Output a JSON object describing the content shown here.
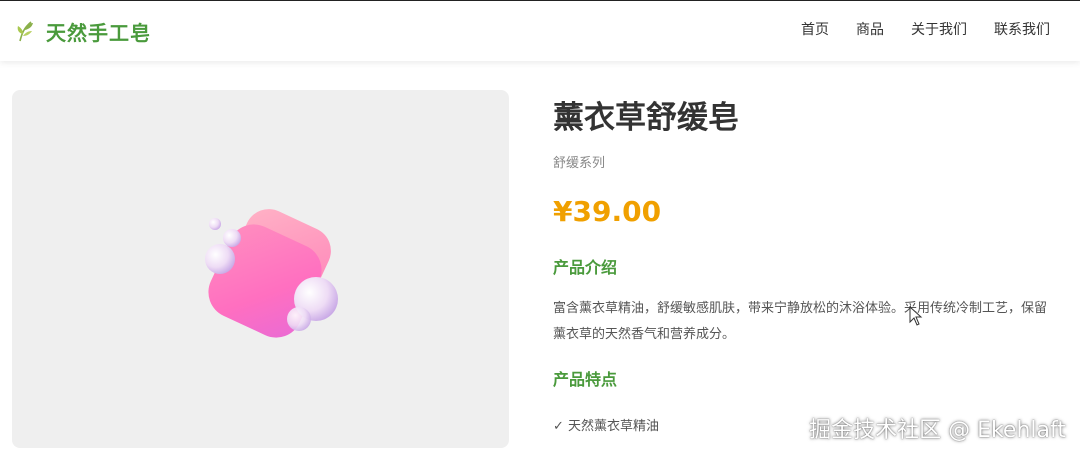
{
  "header": {
    "brand_name": "天然手工皂",
    "brand_icon": "leaf-icon",
    "brand_color": "#4a9a3c",
    "nav": [
      {
        "label": "首页"
      },
      {
        "label": "商品"
      },
      {
        "label": "关于我们"
      },
      {
        "label": "联系我们"
      }
    ]
  },
  "product": {
    "image_icon": "soap-icon",
    "title": "薰衣草舒缓皂",
    "series": "舒缓系列",
    "price": "¥39.00",
    "price_color": "#f0a000",
    "intro_heading": "产品介绍",
    "description": "富含薰衣草精油，舒缓敏感肌肤，带来宁静放松的沐浴体验。采用传统冷制工艺，保留薰衣草的天然香气和营养成分。",
    "features_heading": "产品特点",
    "features": [
      "✓ 天然薰衣草精油"
    ]
  },
  "watermark": "掘金技术社区 @ Ekehlaft"
}
